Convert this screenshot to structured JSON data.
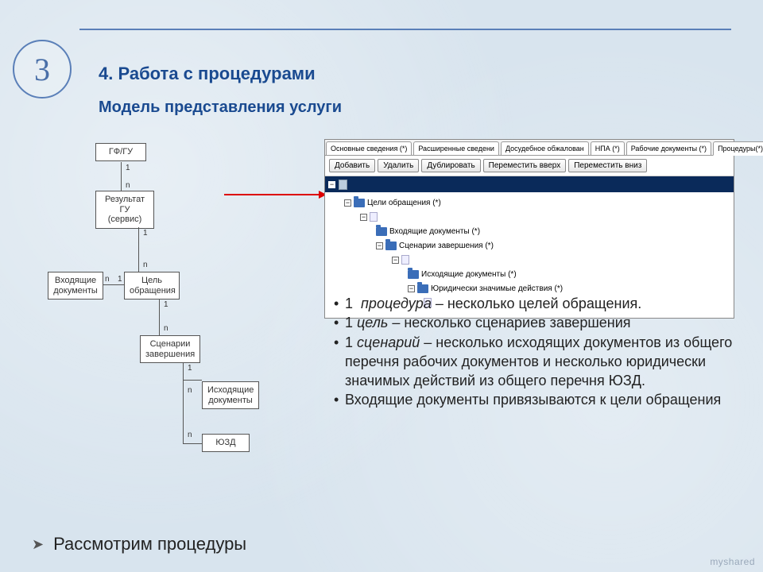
{
  "slide_number": "3",
  "title": "4. Работа с процедурами",
  "subtitle": "Модель представления услуги",
  "diagram": {
    "b1": "ГФ/ГУ",
    "b2_l1": "Результат",
    "b2_l2": "ГУ",
    "b2_l3": "(сервис)",
    "b3_l1": "Входящие",
    "b3_l2": "документы",
    "b4_l1": "Цель",
    "b4_l2": "обращения",
    "b5_l1": "Сценарии",
    "b5_l2": "завершения",
    "b6_l1": "Исходящие",
    "b6_l2": "документы",
    "b7": "ЮЗД",
    "one": "1",
    "n": "n"
  },
  "tabs": [
    "Основные сведения (*)",
    "Расширенные сведени",
    "Досудебное обжалован",
    "НПА (*)",
    "Рабочие документы (*)",
    "Процедуры(*)"
  ],
  "toolbar": [
    "Добавить",
    "Удалить",
    "Дублировать",
    "Переместить вверх",
    "Переместить вниз"
  ],
  "tree": {
    "n0": "Цели обращения (*)",
    "n1": "Входящие документы (*)",
    "n2": "Сценарии завершения (*)",
    "n3": "Исходящие документы (*)",
    "n4": "Юридически значимые действия (*)"
  },
  "bullets": {
    "b1a": "1",
    "b1b": "процедура",
    "b1c": " – несколько целей обращения.",
    "b2a": "1 ",
    "b2b": "цель",
    "b2c": " – несколько сценариев завершения",
    "b3a": "1 ",
    "b3b": "сценарий",
    "b3c": " – несколько исходящих документов из общего перечня рабочих документов и несколько юридически значимых действий из общего перечня ЮЗД.",
    "b4": "Входящие документы привязываются к цели обращения"
  },
  "footer": "Рассмотрим процедуры",
  "watermark": "myshared"
}
